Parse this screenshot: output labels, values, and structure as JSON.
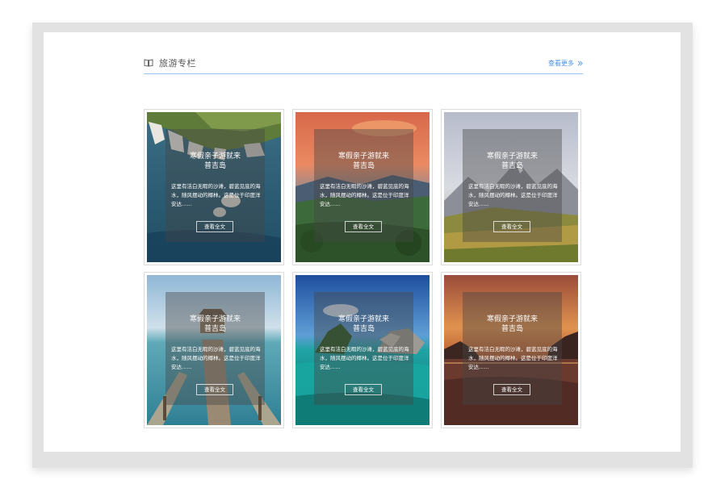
{
  "section": {
    "title": "旅游专栏",
    "more_link": "查看更多"
  },
  "cards": [
    {
      "title_line1": "寒假亲子游就来",
      "title_line2": "普吉岛",
      "desc": "这里有洁白无暇的沙滩，碧蓝见底的海水，随风摆动的椰林。这是位于印度洋安达......",
      "button": "查看全文"
    },
    {
      "title_line1": "寒假亲子游就来",
      "title_line2": "普吉岛",
      "desc": "这里有洁白无暇的沙滩，碧蓝见底的海水，随风摆动的椰林。这是位于印度洋安达......",
      "button": "查看全文"
    },
    {
      "title_line1": "寒假亲子游就来",
      "title_line2": "普吉岛",
      "desc": "这里有洁白无暇的沙滩，碧蓝见底的海水，随风摆动的椰林。这是位于印度洋安达......",
      "button": "查看全文"
    },
    {
      "title_line1": "寒假亲子游就来",
      "title_line2": "普吉岛",
      "desc": "这里有洁白无暇的沙滩，碧蓝见底的海水，随风摆动的椰林。这是位于印度洋安达......",
      "button": "查看全文"
    },
    {
      "title_line1": "寒假亲子游就来",
      "title_line2": "普吉岛",
      "desc": "这里有洁白无暇的沙滩，碧蓝见底的海水，随风摆动的椰林。这是位于印度洋安达......",
      "button": "查看全文"
    },
    {
      "title_line1": "寒假亲子游就来",
      "title_line2": "普吉岛",
      "desc": "这里有洁白无暇的沙滩，碧蓝见底的海水，随风摆动的椰林。这是位于印度洋安达......",
      "button": "查看全文"
    }
  ],
  "icons": {
    "header": "book-icon",
    "more": "double-chevron-right-icon"
  },
  "colors": {
    "accent": "#4a90e2",
    "divider": "#9cc4f4"
  }
}
